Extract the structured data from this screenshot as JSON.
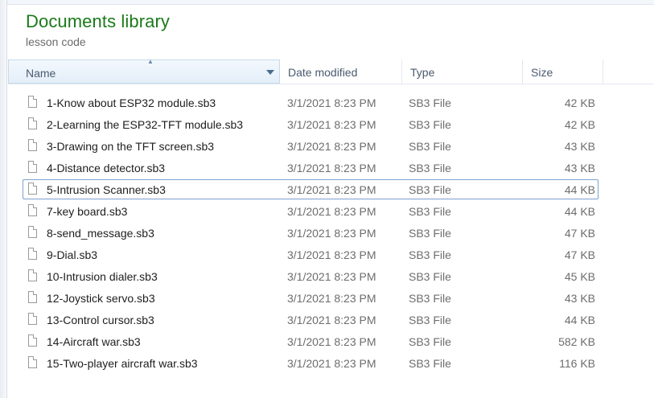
{
  "library": {
    "title": "Documents library",
    "subtitle": "lesson code"
  },
  "columns": {
    "name": "Name",
    "date": "Date modified",
    "type": "Type",
    "size": "Size"
  },
  "files": [
    {
      "name": "1-Know about ESP32 module.sb3",
      "date": "3/1/2021 8:23 PM",
      "type": "SB3 File",
      "size": "42 KB"
    },
    {
      "name": "2-Learning the ESP32-TFT module.sb3",
      "date": "3/1/2021 8:23 PM",
      "type": "SB3 File",
      "size": "42 KB"
    },
    {
      "name": "3-Drawing on the TFT screen.sb3",
      "date": "3/1/2021 8:23 PM",
      "type": "SB3 File",
      "size": "43 KB"
    },
    {
      "name": "4-Distance detector.sb3",
      "date": "3/1/2021 8:23 PM",
      "type": "SB3 File",
      "size": "43 KB"
    },
    {
      "name": "5-Intrusion Scanner.sb3",
      "date": "3/1/2021 8:23 PM",
      "type": "SB3 File",
      "size": "44 KB"
    },
    {
      "name": "7-key board.sb3",
      "date": "3/1/2021 8:23 PM",
      "type": "SB3 File",
      "size": "44 KB"
    },
    {
      "name": "8-send_message.sb3",
      "date": "3/1/2021 8:23 PM",
      "type": "SB3 File",
      "size": "47 KB"
    },
    {
      "name": "9-Dial.sb3",
      "date": "3/1/2021 8:23 PM",
      "type": "SB3 File",
      "size": "47 KB"
    },
    {
      "name": "10-Intrusion dialer.sb3",
      "date": "3/1/2021 8:23 PM",
      "type": "SB3 File",
      "size": "45 KB"
    },
    {
      "name": "12-Joystick servo.sb3",
      "date": "3/1/2021 8:23 PM",
      "type": "SB3 File",
      "size": "43 KB"
    },
    {
      "name": "13-Control cursor.sb3",
      "date": "3/1/2021 8:23 PM",
      "type": "SB3 File",
      "size": "44 KB"
    },
    {
      "name": "14-Aircraft war.sb3",
      "date": "3/1/2021 8:23 PM",
      "type": "SB3 File",
      "size": "582 KB"
    },
    {
      "name": "15-Two-player aircraft war.sb3",
      "date": "3/1/2021 8:23 PM",
      "type": "SB3 File",
      "size": "116 KB"
    }
  ]
}
